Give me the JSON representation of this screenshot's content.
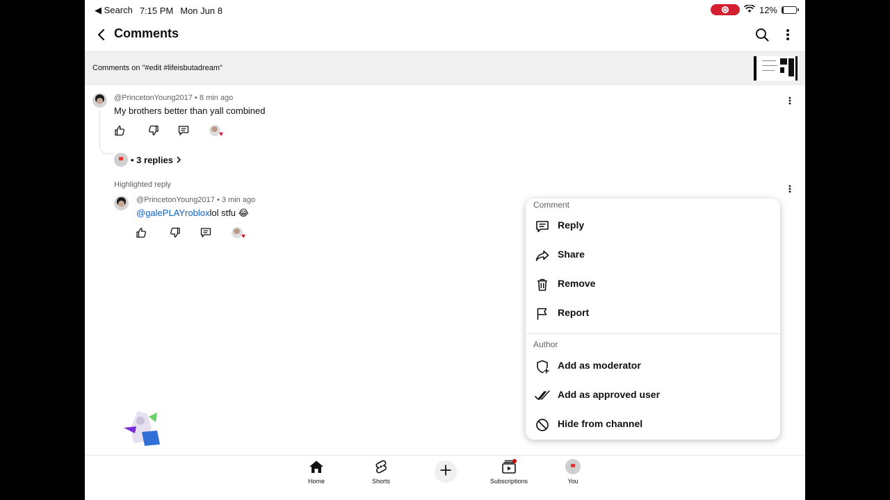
{
  "status_bar": {
    "back_app": "◀ Search",
    "time": "7:15 PM",
    "date": "Mon Jun 8",
    "battery": "12%",
    "battery_level": 0.12,
    "recording_color": "#d32030"
  },
  "header": {
    "title": "Comments",
    "icons": [
      "back-arrow-icon",
      "search-icon",
      "more-vert-icon"
    ]
  },
  "context_bar": {
    "text": "Comments on \"#edit #lifeisbutadream\""
  },
  "comment": {
    "author": "@PrincetonYoung2017",
    "time": "8 min ago",
    "text": "My brothers better than yall combined",
    "replies_label": "• 3 replies"
  },
  "highlighted": {
    "label": "Highlighted reply",
    "author": "@PrincetonYoung2017",
    "time": "3 min ago",
    "mention": "@galePLAYroblox",
    "text": "lol stfu 😂"
  },
  "menu": {
    "comment_heading": "Comment",
    "comment_items": [
      {
        "label": "Reply",
        "icon": "reply-icon"
      },
      {
        "label": "Share",
        "icon": "share-icon"
      },
      {
        "label": "Remove",
        "icon": "trash-icon"
      },
      {
        "label": "Report",
        "icon": "flag-icon"
      }
    ],
    "author_heading": "Author",
    "author_items": [
      {
        "label": "Add as moderator",
        "icon": "shield-plus-icon"
      },
      {
        "label": "Add as approved user",
        "icon": "double-check-icon"
      },
      {
        "label": "Hide from channel",
        "icon": "block-icon"
      }
    ]
  },
  "bottom_nav": {
    "items": [
      {
        "label": "Home",
        "icon": "home-icon"
      },
      {
        "label": "Shorts",
        "icon": "shorts-icon"
      },
      {
        "label": "",
        "icon": "plus-icon"
      },
      {
        "label": "Subscriptions",
        "icon": "subscriptions-icon"
      },
      {
        "label": "You",
        "icon": "avatar"
      }
    ]
  },
  "colors": {
    "accent_link": "#065fd4",
    "heart": "#d61b3a",
    "notification_dot": "#cc0000"
  }
}
